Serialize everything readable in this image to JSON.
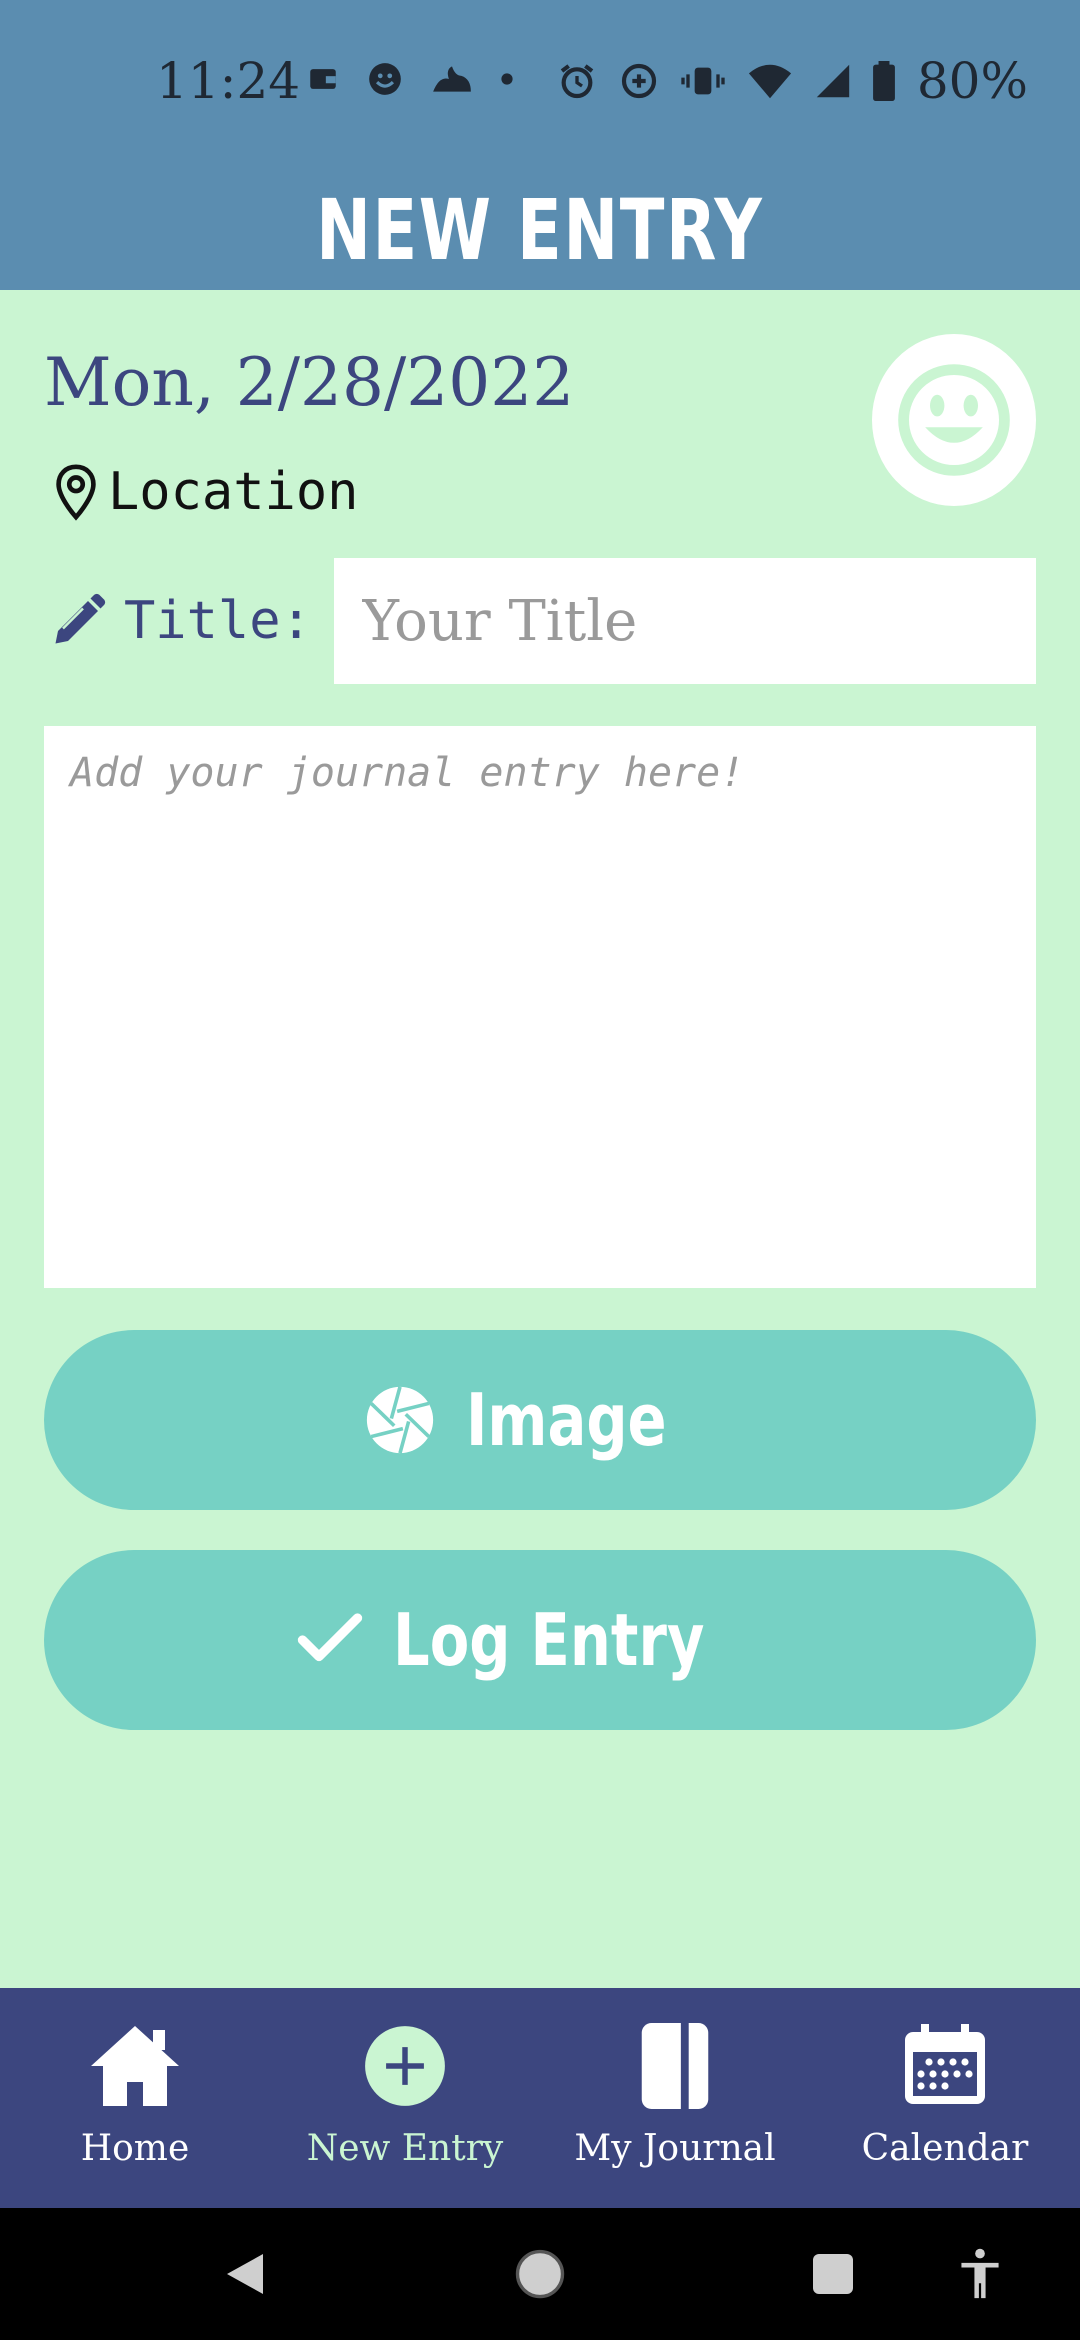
{
  "status_bar": {
    "time": "11:24",
    "battery": "80%",
    "icons": [
      "wallet-icon",
      "face-icon",
      "fire-icon",
      "dot-icon",
      "alarm-icon",
      "data-saver-icon",
      "vibrate-icon",
      "wifi-icon",
      "signal-icon",
      "battery-icon"
    ]
  },
  "header": {
    "title": "NEW ENTRY"
  },
  "entry": {
    "date": "Mon, 2/28/2022",
    "location_label": "Location",
    "title_label": "Title:",
    "title_placeholder": "Your Title",
    "title_value": "",
    "body_placeholder": "Add your journal entry here!",
    "body_value": "",
    "mood_icon": "smiley-icon"
  },
  "actions": {
    "image_label": "Image",
    "log_label": "Log Entry"
  },
  "bottom_nav": {
    "items": [
      {
        "label": "Home",
        "icon": "home-icon"
      },
      {
        "label": "New Entry",
        "icon": "plus-circle-icon",
        "active": true
      },
      {
        "label": "My Journal",
        "icon": "journal-icon"
      },
      {
        "label": "Calendar",
        "icon": "calendar-icon"
      }
    ]
  },
  "system_nav": [
    "back-icon",
    "home-circle-icon",
    "recents-icon",
    "accessibility-icon"
  ],
  "colors": {
    "header_bg": "#5b8db0",
    "page_bg": "#caf5d2",
    "accent_button": "#76d1c4",
    "nav_bg": "#3c467f",
    "text_primary": "#3c467f"
  }
}
